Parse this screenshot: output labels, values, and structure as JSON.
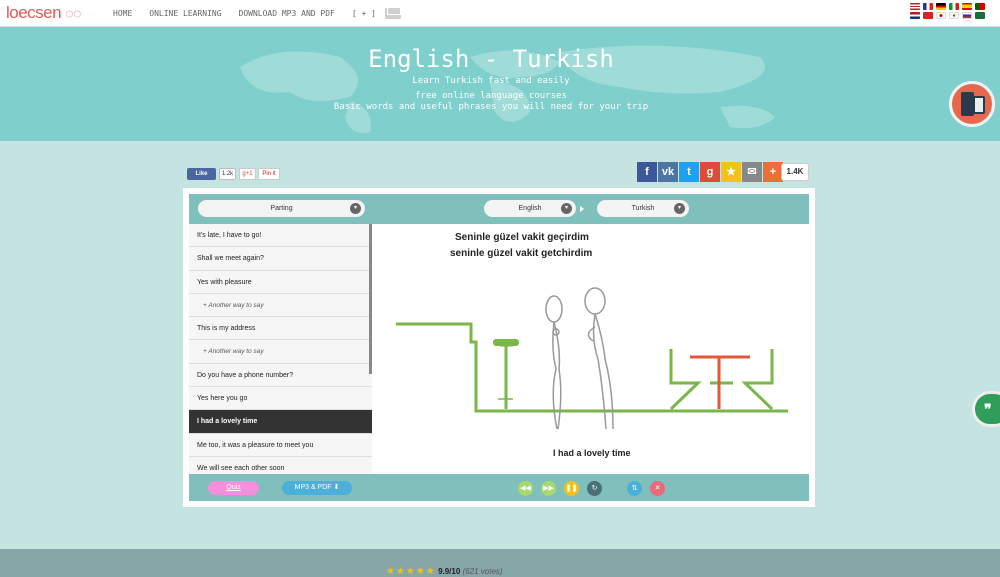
{
  "header": {
    "logo": "loecsen",
    "nav": [
      "HOME",
      "ONLINE LEARNING",
      "DOWNLOAD MP3 AND PDF",
      "[ + ]"
    ]
  },
  "hero": {
    "title": "English - Turkish",
    "tagline": "Learn Turkish fast and easily",
    "line2": "free online language courses",
    "line3": "Basic words and useful phrases you will need for your trip"
  },
  "social": {
    "fb_like": "Like",
    "fb_count": "1.2k",
    "gplus": "g+1",
    "pinit": "Pin it",
    "share_count": "1.4K"
  },
  "selectors": {
    "category": "Parting",
    "from_lang": "English",
    "to_lang": "Turkish"
  },
  "phrases": [
    {
      "text": "It's late, I have to go!",
      "type": "item"
    },
    {
      "text": "Shall we meet again?",
      "type": "item"
    },
    {
      "text": "Yes with pleasure",
      "type": "item"
    },
    {
      "text": "+ Another way to say",
      "type": "alt"
    },
    {
      "text": "This is my address",
      "type": "item"
    },
    {
      "text": "+ Another way to say",
      "type": "alt"
    },
    {
      "text": "Do you have a phone number?",
      "type": "item"
    },
    {
      "text": "Yes here you go",
      "type": "item"
    },
    {
      "text": "I had a lovely time",
      "type": "active"
    },
    {
      "text": "Me too, it was a pleasure to meet you",
      "type": "item"
    },
    {
      "text": "We will see each other soon",
      "type": "item"
    }
  ],
  "stage": {
    "translation": "Seninle güzel vakit geçirdim",
    "pronunciation": "seninle güzel vakit getchirdim",
    "caption": "I had a lovely time"
  },
  "controls": {
    "quiz": "Quiz",
    "mp3_pdf": "MP3 & PDF ⬇"
  },
  "footer": {
    "stars": "★★★★★",
    "score": "9.9/10",
    "votes": "(621 votes)"
  },
  "colors": {
    "hero": "#7fcfcc",
    "panel_bar": "#7fbfbc",
    "accent_green": "#7ab648",
    "accent_red": "#e05a3a"
  }
}
